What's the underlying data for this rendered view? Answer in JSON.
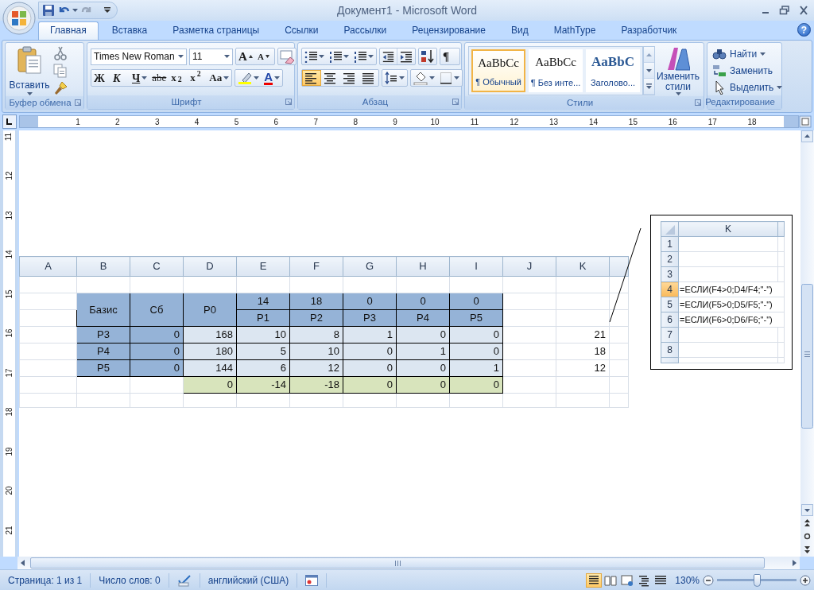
{
  "title_bar": {
    "title": "Документ1 - Microsoft Word"
  },
  "tabs": [
    {
      "label": "Главная",
      "selected": true
    },
    {
      "label": "Вставка",
      "selected": false
    },
    {
      "label": "Разметка страницы",
      "selected": false
    },
    {
      "label": "Ссылки",
      "selected": false
    },
    {
      "label": "Рассылки",
      "selected": false
    },
    {
      "label": "Рецензирование",
      "selected": false
    },
    {
      "label": "Вид",
      "selected": false
    },
    {
      "label": "MathType",
      "selected": false
    },
    {
      "label": "Разработчик",
      "selected": false
    }
  ],
  "help_label": "?",
  "ribbon": {
    "clipboard": {
      "paste_label": "Вставить",
      "title": "Буфер обмена"
    },
    "font": {
      "font_name": "Times New Roman",
      "font_size": "11",
      "grow_label": "A",
      "shrink_label": "A",
      "format_buttons": [
        {
          "label": "Ж",
          "kind": "bold"
        },
        {
          "label": "К",
          "kind": "italic"
        },
        {
          "label": "Ч",
          "kind": "underline"
        },
        {
          "label": "abe",
          "kind": "strike"
        },
        {
          "label": "x$_{2}$",
          "kind": "script"
        },
        {
          "label": "x$^{2}$",
          "kind": "script"
        },
        {
          "label": "Aa",
          "kind": "case"
        }
      ],
      "color_label": "A",
      "title": "Шрифт"
    },
    "paragraph": {
      "pilcrow": "¶",
      "alignments": [
        {
          "kind": "left",
          "selected": true
        },
        {
          "kind": "center",
          "selected": false
        },
        {
          "kind": "right",
          "selected": false
        },
        {
          "kind": "justify",
          "selected": false
        }
      ],
      "title": "Абзац"
    },
    "styles": {
      "gallery": [
        {
          "preview": "AaBbCc",
          "label": "¶ Обычный",
          "kind": "normal",
          "selected": true
        },
        {
          "preview": "AaBbCc",
          "label": "¶ Без инте...",
          "kind": "normal",
          "selected": false
        },
        {
          "preview": "AaBbC",
          "label": "Заголово...",
          "kind": "heading",
          "selected": false
        }
      ],
      "change_label": "Изменить стили",
      "title": "Стили"
    },
    "editing": {
      "commands": [
        {
          "label": "Найти",
          "kind": "find",
          "dropdown": true
        },
        {
          "label": "Заменить",
          "kind": "replace",
          "dropdown": false
        },
        {
          "label": "Выделить",
          "kind": "select",
          "dropdown": true
        }
      ],
      "title": "Редактирование"
    }
  },
  "horizontal_ruler": {
    "numbers": [
      "1",
      "2",
      "3",
      "4",
      "5",
      "6",
      "7",
      "8",
      "9",
      "10",
      "11",
      "12",
      "13",
      "14",
      "15",
      "16",
      "17",
      "18"
    ]
  },
  "vertical_ruler": {
    "numbers": [
      "11",
      "12",
      "13",
      "14",
      "15",
      "16",
      "17",
      "18",
      "19",
      "20",
      "21"
    ]
  },
  "spreadsheet": {
    "columns": [
      "A",
      "B",
      "C",
      "D",
      "E",
      "F",
      "G",
      "H",
      "I",
      "J",
      "K"
    ],
    "header": {
      "basis": "Базис",
      "cb": "Сб",
      "p0": "P0",
      "coefficients": [
        "14",
        "18",
        "0",
        "0",
        "0"
      ],
      "vectors": [
        "P1",
        "P2",
        "P3",
        "P4",
        "P5"
      ]
    },
    "rows": [
      {
        "basis": "P3",
        "cb": "0",
        "values": [
          "168",
          "10",
          "8",
          "1",
          "0",
          "0"
        ],
        "ratio": "21"
      },
      {
        "basis": "P4",
        "cb": "0",
        "values": [
          "180",
          "5",
          "10",
          "0",
          "1",
          "0"
        ],
        "ratio": "18"
      },
      {
        "basis": "P5",
        "cb": "0",
        "values": [
          "144",
          "6",
          "12",
          "0",
          "0",
          "1"
        ],
        "ratio": "12"
      }
    ],
    "delta_row": [
      "0",
      "-14",
      "-18",
      "0",
      "0",
      "0"
    ]
  },
  "formula_inset": {
    "column": "K",
    "rows": [
      {
        "number": "1",
        "selected": false
      },
      {
        "number": "2",
        "selected": false
      },
      {
        "number": "3",
        "selected": false
      },
      {
        "number": "4",
        "formula": "=ЕСЛИ(F4>0;D4/F4;\"-\")",
        "selected": true
      },
      {
        "number": "5",
        "formula": "=ЕСЛИ(F5>0;D5/F5;\"-\")",
        "selected": false
      },
      {
        "number": "6",
        "formula": "=ЕСЛИ(F6>0;D6/F6;\"-\")",
        "selected": false
      },
      {
        "number": "7",
        "selected": false
      },
      {
        "number": "8",
        "selected": false
      }
    ]
  },
  "status_bar": {
    "page": "Страница: 1 из 1",
    "words": "Число слов: 0",
    "language": "английский (США)",
    "views": [
      {
        "kind": "print",
        "selected": true
      },
      {
        "kind": "reading",
        "selected": false
      },
      {
        "kind": "web",
        "selected": false
      },
      {
        "kind": "outline",
        "selected": false
      },
      {
        "kind": "draft",
        "selected": false
      }
    ],
    "zoom": "130%",
    "zoom_slider": {
      "level": 0.5
    }
  }
}
